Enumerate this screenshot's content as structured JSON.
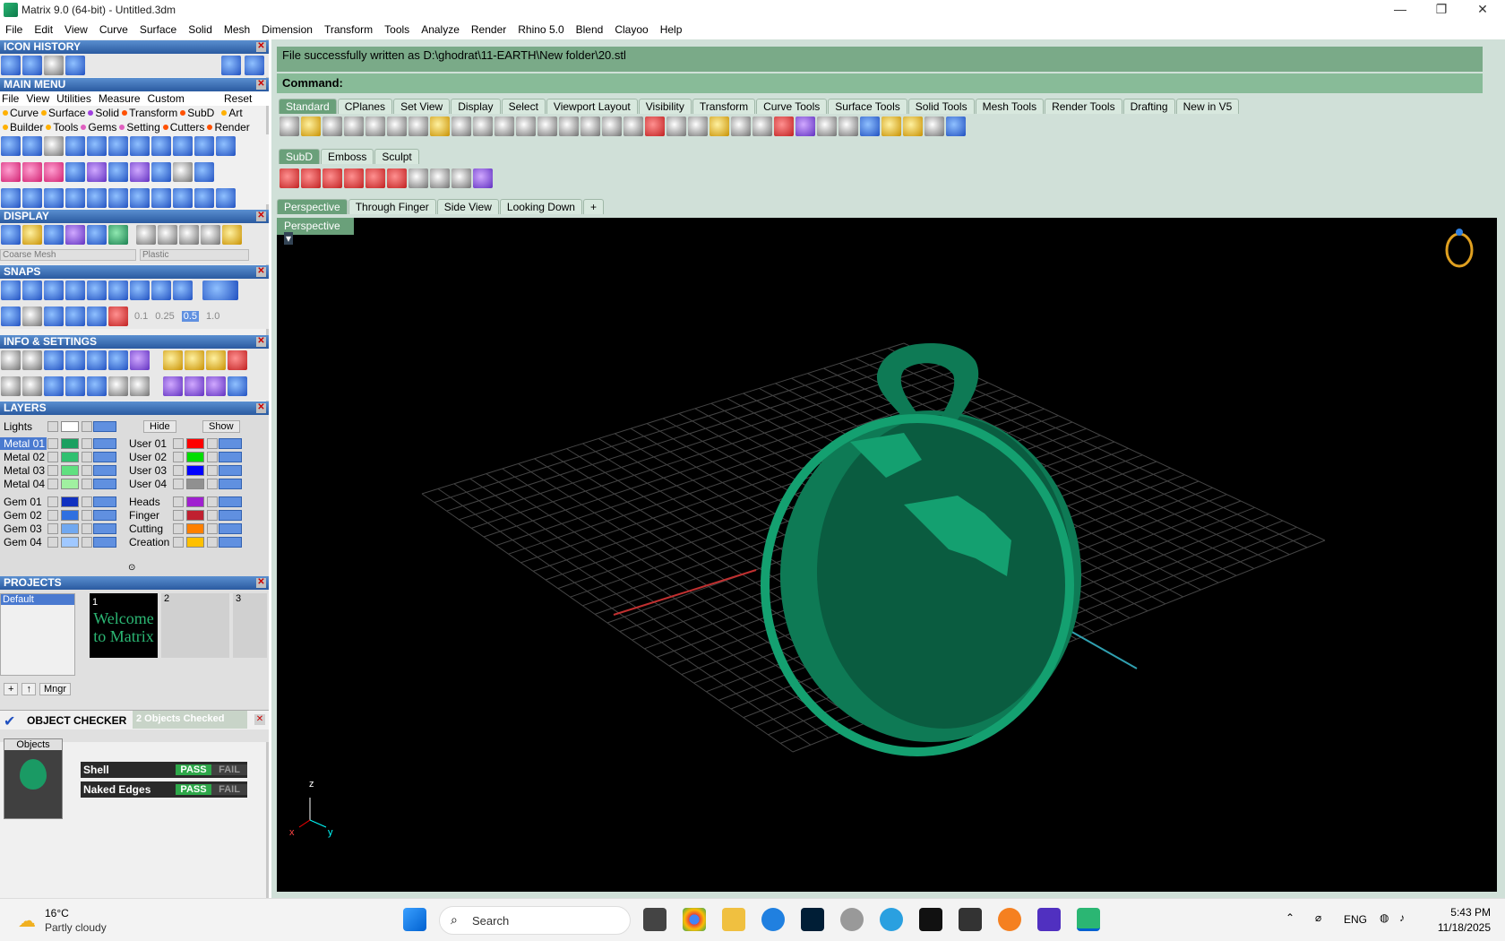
{
  "window": {
    "title": "Matrix 9.0 (64-bit) - Untitled.3dm",
    "min": "—",
    "max": "❐",
    "close": "✕"
  },
  "menubar": [
    "File",
    "Edit",
    "View",
    "Curve",
    "Surface",
    "Solid",
    "Mesh",
    "Dimension",
    "Transform",
    "Tools",
    "Analyze",
    "Render",
    "Rhino 5.0",
    "Blend",
    "Clayoo",
    "Help"
  ],
  "left": {
    "icon_history": "ICON HISTORY",
    "main_menu": "MAIN MENU",
    "main_menu_items": [
      "File",
      "View",
      "Utilities",
      "Measure",
      "Custom"
    ],
    "reset": "Reset",
    "row1": [
      "Curve",
      "Surface",
      "Solid",
      "Transform",
      "SubD",
      "Art"
    ],
    "row2": [
      "Builder",
      "Tools",
      "Gems",
      "Setting",
      "Cutters",
      "Render"
    ],
    "display": "DISPLAY",
    "display_mesh": "Coarse Mesh",
    "display_material": "Plastic",
    "snaps": "SNAPS",
    "snap_values": [
      "0.1",
      "0.25",
      "0.5",
      "1.0"
    ],
    "info": "INFO & SETTINGS",
    "layers": "LAYERS",
    "lights": "Lights",
    "hide": "Hide",
    "show": "Show",
    "layers_left": [
      {
        "name": "Metal 01",
        "color": "#1aa060"
      },
      {
        "name": "Metal 02",
        "color": "#30c070"
      },
      {
        "name": "Metal 03",
        "color": "#60e080"
      },
      {
        "name": "Metal 04",
        "color": "#a0f0a0"
      },
      {
        "name": "Gem 01",
        "color": "#1030c0"
      },
      {
        "name": "Gem 02",
        "color": "#3070e0"
      },
      {
        "name": "Gem 03",
        "color": "#70a8f0"
      },
      {
        "name": "Gem 04",
        "color": "#a0c8ff"
      }
    ],
    "layers_right": [
      {
        "name": "User 01",
        "color": "#ff0000"
      },
      {
        "name": "User 02",
        "color": "#00dd00"
      },
      {
        "name": "User 03",
        "color": "#0000ff"
      },
      {
        "name": "User 04",
        "color": "#909090"
      },
      {
        "name": "Heads",
        "color": "#a020d0"
      },
      {
        "name": "Finger",
        "color": "#c02030"
      },
      {
        "name": "Cutting",
        "color": "#ff8000"
      },
      {
        "name": "Creation",
        "color": "#ffc000"
      }
    ],
    "projects": "PROJECTS",
    "project_default": "Default",
    "project_slots": [
      "1",
      "2",
      "3"
    ],
    "welcome": "Welcome to Matrix",
    "mngr": "Mngr",
    "checker": "OBJECT CHECKER",
    "checked": "2 Objects Checked",
    "objects": "Objects",
    "checks": [
      {
        "label": "Shell",
        "pass": "PASS",
        "fail": "FAIL"
      },
      {
        "label": "Naked Edges",
        "pass": "PASS",
        "fail": "FAIL"
      }
    ]
  },
  "cmd": {
    "history": "File successfully written as D:\\ghodrat\\11-EARTH\\New folder\\20.stl",
    "prompt": "Command:"
  },
  "toolbar_tabs": [
    "Standard",
    "CPlanes",
    "Set View",
    "Display",
    "Select",
    "Viewport Layout",
    "Visibility",
    "Transform",
    "Curve Tools",
    "Surface Tools",
    "Solid Tools",
    "Mesh Tools",
    "Render Tools",
    "Drafting",
    "New in V5"
  ],
  "sub_tabs": [
    "SubD",
    "Emboss",
    "Sculpt"
  ],
  "view_tabs": [
    "Perspective",
    "Through Finger",
    "Side View",
    "Looking Down",
    "+"
  ],
  "viewport": {
    "label": "Perspective",
    "axis_z": "z",
    "axis_x": "x",
    "axis_y": "y"
  },
  "taskbar": {
    "temp": "16°C",
    "weather": "Partly cloudy",
    "search": "Search",
    "lang": "ENG",
    "time": "5:43 PM",
    "date": "11/18/2025"
  }
}
